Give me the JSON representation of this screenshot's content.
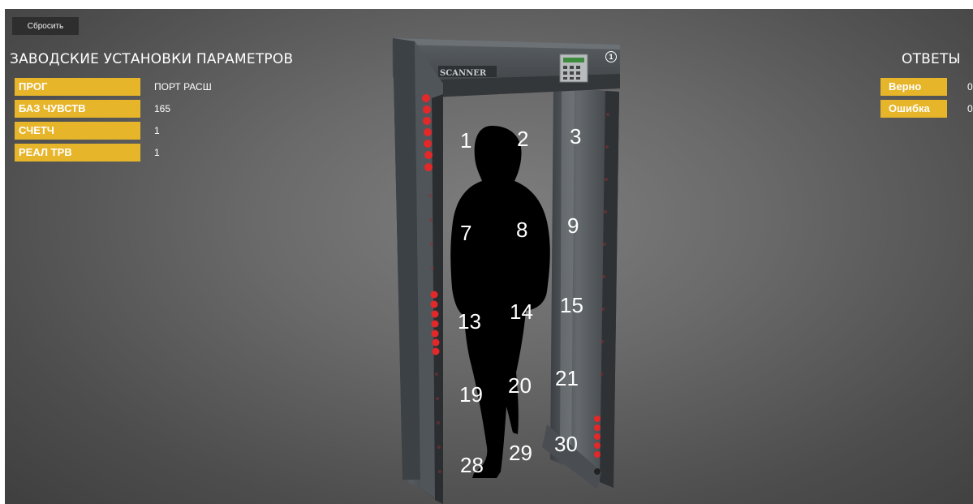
{
  "controls": {
    "reset_label": "Сбросить"
  },
  "settings": {
    "title": "ЗАВОДСКИЕ УСТАНОВКИ ПАРАМЕТРОВ",
    "rows": [
      {
        "label": "ПРОГ",
        "value": "ПОРТ РАСШ"
      },
      {
        "label": "БАЗ ЧУВСТВ",
        "value": "165"
      },
      {
        "label": "СЧЕТЧ",
        "value": "1"
      },
      {
        "label": "РЕАЛ ТРВ",
        "value": "1"
      }
    ]
  },
  "answers": {
    "title": "ОТВЕТЫ",
    "rows": [
      {
        "label": "Верно",
        "value": "0"
      },
      {
        "label": "Ошибка",
        "value": "0"
      }
    ]
  },
  "scanner": {
    "brand": "SCANNER",
    "info_badge": "1",
    "zones": [
      "1",
      "2",
      "3",
      "7",
      "8",
      "9",
      "13",
      "14",
      "15",
      "19",
      "20",
      "21",
      "28",
      "29",
      "30"
    ]
  },
  "colors": {
    "accent": "#e7b52a",
    "led": "#e3282a",
    "background": "#6a6a6a"
  },
  "icons": {
    "info": "info-circle-icon",
    "silhouette": "person-silhouette-icon"
  }
}
